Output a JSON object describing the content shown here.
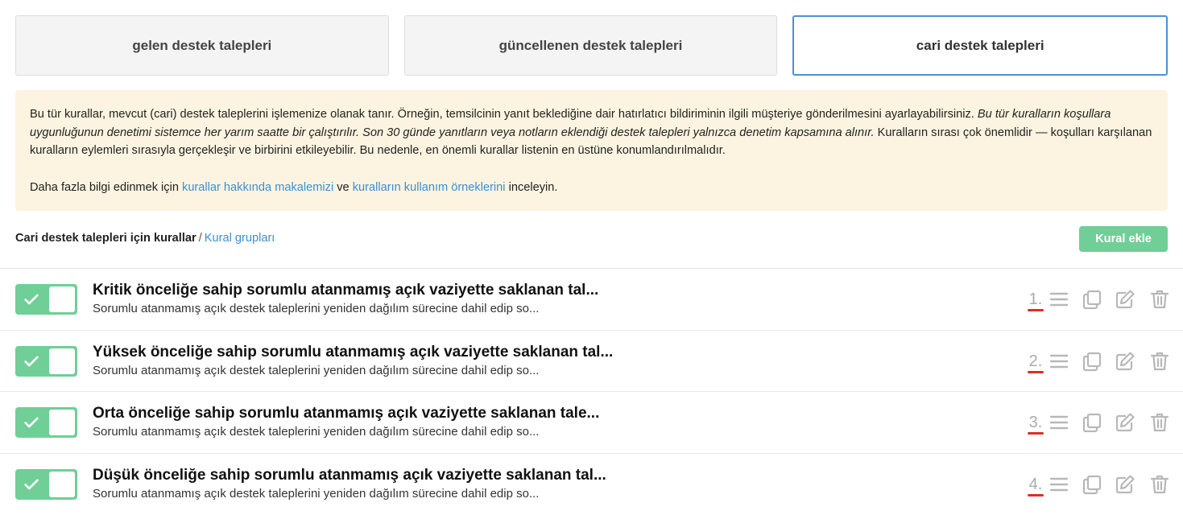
{
  "tabs": [
    {
      "label": "gelen destek talepleri"
    },
    {
      "label": "güncellenen destek talepleri"
    },
    {
      "label": "cari destek talepleri"
    }
  ],
  "info": {
    "text1": "Bu tür kurallar, mevcut (cari) destek taleplerini işlemenize olanak tanır. Örneğin, temsilcinin yanıt beklediğine dair hatırlatıcı bildiriminin ilgili müşteriye gönderilmesini ayarlayabilirsiniz. ",
    "text_italic": "Bu tür kuralların koşullara uygunluğunun denetimi sistemce her yarım saatte bir çalıştırılır. Son 30 günde yanıtların veya notların eklendiği destek talepleri yalnızca denetim kapsamına alınır.",
    "text2": " Kuralların sırası çok önemlidir — koşulları karşılanan kuralların eylemleri sırasıyla gerçekleşir ve birbirini etkileyebilir. Bu nedenle, en önemli kurallar listenin en üstüne konumlandırılmalıdır.",
    "more_prefix": "Daha fazla bilgi edinmek için ",
    "link1": "kurallar hakkında makalemizi",
    "more_mid": " ve ",
    "link2": "kuralların kullanım örneklerini",
    "more_suffix": " inceleyin."
  },
  "breadcrumb": {
    "current": "Cari destek talepleri için kurallar",
    "separator": "/",
    "link": "Kural grupları"
  },
  "add_button": "Kural ekle",
  "rules": [
    {
      "title": "Kritik önceliğe sahip sorumlu atanmamış açık vaziyette saklanan tal...",
      "description": "Sorumlu atanmamış açık destek taleplerini yeniden dağılım sürecine dahil edip so...",
      "order": "1.",
      "enabled": true
    },
    {
      "title": "Yüksek önceliğe sahip sorumlu atanmamış açık vaziyette saklanan tal...",
      "description": "Sorumlu atanmamış açık destek taleplerini yeniden dağılım sürecine dahil edip so...",
      "order": "2.",
      "enabled": true
    },
    {
      "title": "Orta önceliğe sahip sorumlu atanmamış açık vaziyette saklanan tale...",
      "description": "Sorumlu atanmamış açık destek taleplerini yeniden dağılım sürecine dahil edip so...",
      "order": "3.",
      "enabled": true
    },
    {
      "title": "Düşük önceliğe sahip sorumlu atanmamış açık vaziyette saklanan tal...",
      "description": "Sorumlu atanmamış açık destek taleplerini yeniden dağılım sürecine dahil edip so...",
      "order": "4.",
      "enabled": true
    }
  ],
  "icons": {
    "check": "check-icon",
    "drag": "drag-handle-icon",
    "copy": "copy-icon",
    "edit": "edit-icon",
    "delete": "trash-icon"
  },
  "colors": {
    "accent": "#4a90d9",
    "toggle_on": "#6fcf97",
    "link": "#3a8fd6",
    "info_bg": "#fcf4e0",
    "order_underline": "#d93025"
  }
}
